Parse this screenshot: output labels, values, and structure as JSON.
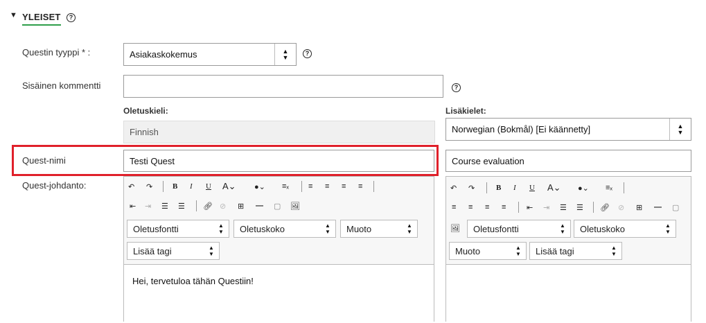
{
  "section": {
    "toggle": "▼",
    "title": "YLEISET"
  },
  "labels": {
    "quest_type": "Questin tyyppi * :",
    "internal_comment": "Sisäinen kommentti",
    "default_lang": "Oletuskieli:",
    "extra_langs": "Lisäkielet:",
    "quest_name": "Quest-nimi",
    "quest_intro": "Quest-johdanto:"
  },
  "fields": {
    "quest_type_value": "Asiakaskokemus",
    "internal_comment_value": "",
    "default_lang_value": "Finnish",
    "extra_lang_value": "Norwegian (Bokmål) [Ei käännetty]",
    "quest_name_value": "Testi Quest",
    "quest_name_translation": "Course evaluation"
  },
  "editor": {
    "font": "Oletusfontti",
    "size": "Oletuskoko",
    "format": "Muoto",
    "tag": "Lisää tagi",
    "content": "Hei, tervetuloa tähän Questiin!"
  },
  "help_glyph": "?",
  "colors": {
    "highlight": "#e0202a",
    "underline": "#2e9e4a"
  }
}
